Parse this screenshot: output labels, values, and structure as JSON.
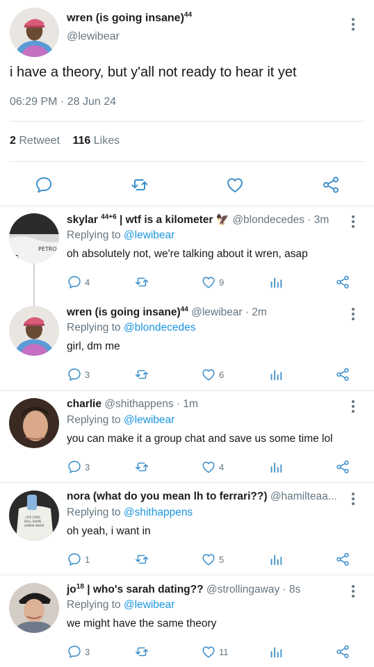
{
  "colors": {
    "accent": "#1b95e0",
    "muted": "#66757f",
    "icon": "#3d8fca",
    "divider": "#e1e8ed"
  },
  "main_tweet": {
    "name": "wren (is going insane)",
    "name_sup": "44",
    "handle": "@lewibear",
    "text": "i have a theory, but y'all not ready to hear it yet",
    "timestamp": "06:29 PM · 28 Jun 24",
    "retweet_count": "2",
    "retweet_label": "Retweet",
    "like_count": "116",
    "like_label": "Likes",
    "actions": [
      "reply-icon",
      "retweet-icon",
      "heart-icon",
      "share-icon"
    ]
  },
  "replies": [
    {
      "name": "skylar",
      "name_sup": "44+6",
      "name_rest": "| wtf is a kilometer 🦅",
      "handle_time": "@blondecedes · 3m",
      "replying_label": "Replying to",
      "replying_to": "@lewibear",
      "text": "oh absolutely not, we're talking about it wren, asap",
      "reply_count": "4",
      "retweet_count": "",
      "like_count": "9"
    },
    {
      "name": "wren (is going insane)",
      "name_sup": "44",
      "name_rest": "",
      "handle_time": "@lewibear · 2m",
      "replying_label": "Replying to",
      "replying_to": "@blondecedes",
      "text": "girl, dm me",
      "reply_count": "3",
      "retweet_count": "",
      "like_count": "6"
    },
    {
      "name": "charlie",
      "name_sup": "",
      "name_rest": "",
      "handle_time": "@shithappens · 1m",
      "replying_label": "Replying to",
      "replying_to": "@lewibear",
      "text": "you can make it a group chat and save us some time lol",
      "reply_count": "3",
      "retweet_count": "",
      "like_count": "4"
    },
    {
      "name": "nora (what do you mean lh to ferrari??)",
      "name_sup": "",
      "name_rest": "",
      "handle_time": "@hamilteaa...",
      "replying_label": "Replying to",
      "replying_to": "@shithappens",
      "text": "oh yeah, i want in",
      "reply_count": "1",
      "retweet_count": "",
      "like_count": "5"
    },
    {
      "name": "jo",
      "name_sup": "18",
      "name_rest": "| who's sarah dating??",
      "handle_time": "@strollingaway · 8s",
      "replying_label": "Replying to",
      "replying_to": "@lewibear",
      "text": "we might have the same theory",
      "reply_count": "3",
      "retweet_count": "",
      "like_count": "11"
    }
  ]
}
